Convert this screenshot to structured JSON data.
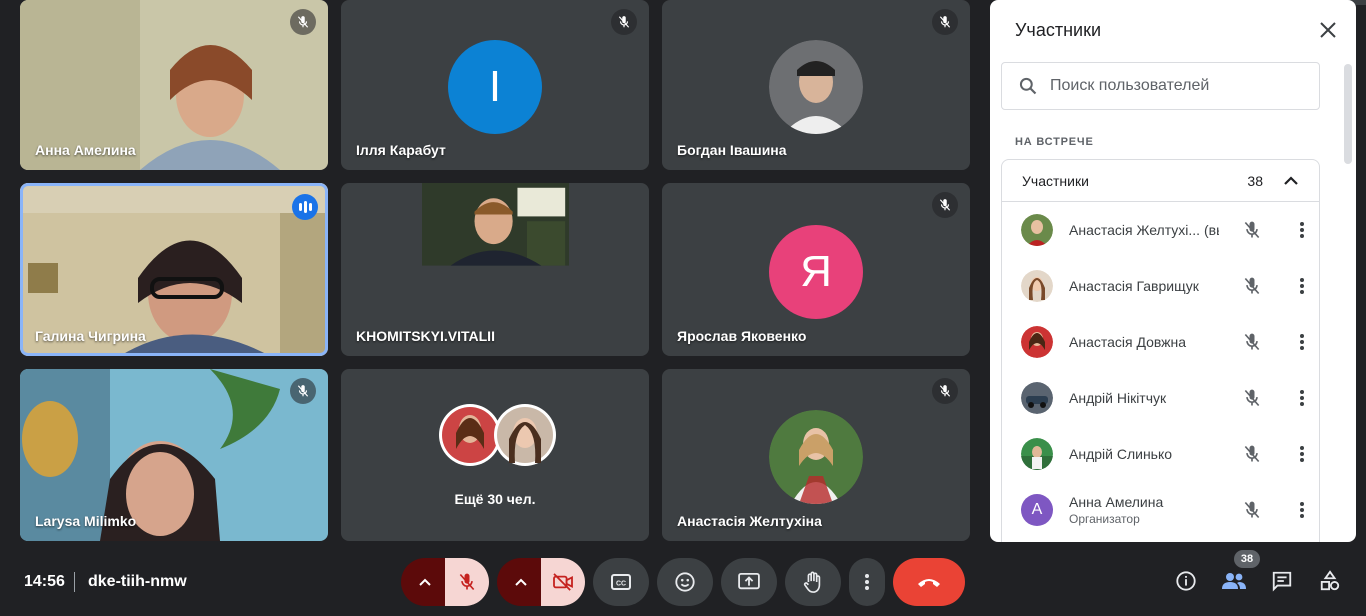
{
  "tiles": {
    "t1": {
      "name": "Анна Амелина"
    },
    "t2": {
      "name": "Ілля Карабут",
      "initial": "І"
    },
    "t3": {
      "name": "Богдан Івашина"
    },
    "t4": {
      "name": "Галина Чигрина"
    },
    "t5": {
      "name": "KHOMITSKYI.VITALII"
    },
    "t6": {
      "name": "Ярослав Яковенко",
      "initial": "Я"
    },
    "t7": {
      "name": "Larysa Milimko"
    },
    "t8": {
      "more": "Ещё 30 чел."
    },
    "t9": {
      "name": "Анастасія Желтухіна"
    }
  },
  "panel": {
    "title": "Участники",
    "search_placeholder": "Поиск пользователей",
    "section": "НА ВСТРЕЧЕ",
    "group_label": "Участники",
    "group_count": "38",
    "people": [
      {
        "name": "Анастасія Желтухі...",
        "suffix": "(вы)",
        "sub": ""
      },
      {
        "name": "Анастасія Гаврищук",
        "suffix": "",
        "sub": ""
      },
      {
        "name": "Анастасія Довжна",
        "suffix": "",
        "sub": ""
      },
      {
        "name": "Андрій Нікітчук",
        "suffix": "",
        "sub": ""
      },
      {
        "name": "Андрій Слинько",
        "suffix": "",
        "sub": ""
      },
      {
        "name": "Анна Амелина",
        "suffix": "",
        "sub": "Организатор",
        "initial": "А"
      }
    ]
  },
  "bar": {
    "time": "14:56",
    "meeting_code": "dke-tiih-nmw",
    "people_badge": "38"
  },
  "colors": {
    "accent_blue": "#1a73e8",
    "end_red": "#ea4335",
    "avatar_blue": "#0c82d4",
    "avatar_pink": "#e8417a",
    "avatar_purple": "#7e57c2"
  }
}
